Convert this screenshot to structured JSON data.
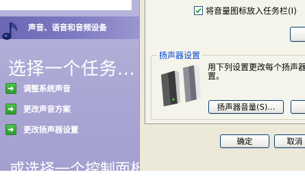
{
  "task_pane": {
    "header_title": "声音、语音和音频设备",
    "pick_task_heading": "选择一个任务...",
    "tasks": [
      {
        "label": "调整系统声音",
        "icon": "green-arrow-icon"
      },
      {
        "label": "更改声音方案",
        "icon": "green-arrow-icon"
      },
      {
        "label": "更改扬声器设置",
        "icon": "green-arrow-icon"
      }
    ],
    "or_pick_heading": "或选择一个控制面板图标"
  },
  "dialog": {
    "checkbox_label": "将音量图标放入任务栏(I)",
    "checkbox_checked": true,
    "speaker_group": {
      "title": "扬声器设置",
      "description_line1": "用下列设置更改每个扬声器",
      "description_line2": "置。",
      "speaker_volume_button": "扬声器音量(S)..."
    },
    "ok_button": "确定",
    "cancel_button": "取消"
  },
  "colors": {
    "task_pane_bg": "#aaa6d4",
    "header_band": "#7f7bc2",
    "dialog_bg": "#ece9d8",
    "group_title": "#0046d5",
    "task_arrow": "#3aa83a"
  }
}
